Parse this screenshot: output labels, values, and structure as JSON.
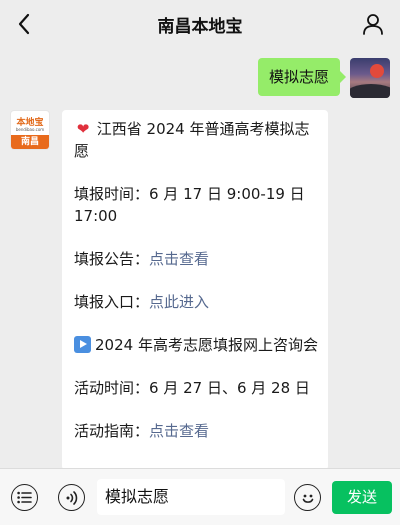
{
  "header": {
    "title": "南昌本地宝",
    "back_icon": "chevron-left-icon",
    "user_icon": "person-icon"
  },
  "me": {
    "message": "模拟志愿"
  },
  "account": {
    "avatar_text_top": "本地宝",
    "avatar_text_url": "bendibao.com",
    "avatar_text_band": "南昌"
  },
  "reply": {
    "section1_title": "江西省 2024 年普通高考模拟志愿",
    "time_label": "填报时间：",
    "time_value": "6 月 17 日 9:00-19 日 17:00",
    "notice_label": "填报公告：",
    "notice_link": "点击查看",
    "entry_label": "填报入口：",
    "entry_link": "点此进入",
    "section2_title": "2024 年高考志愿填报网上咨询会",
    "activity_time_label": "活动时间：",
    "activity_time_value": "6 月 27 日、6 月 28 日",
    "guide_label": "活动指南：",
    "guide_link": "点击查看"
  },
  "composer": {
    "input_value": "模拟志愿",
    "send_label": "发送",
    "menu_icon": "list-icon",
    "voice_icon": "voice-icon",
    "emoji_icon": "emoji-icon"
  },
  "colors": {
    "background": "#ededed",
    "my_bubble": "#95ec69",
    "send_button": "#07c160",
    "link": "#56698f"
  }
}
